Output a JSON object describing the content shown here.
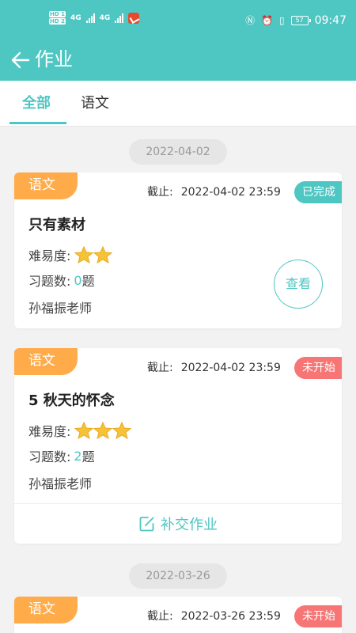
{
  "status_bar": {
    "network_hd1": "HD 1",
    "network_hd2": "HD 2",
    "net_label": "4G",
    "battery": "57",
    "time": "09:47"
  },
  "header": {
    "title": "作业",
    "back_icon": "arrow-left-icon"
  },
  "tabs": [
    {
      "label": "全部",
      "active": true
    },
    {
      "label": "语文",
      "active": false
    }
  ],
  "labels": {
    "deadline": "截止:",
    "difficulty": "难易度:",
    "question_count": "习题数:",
    "question_unit": "题",
    "view_button": "查看",
    "resubmit_button": "补交作业"
  },
  "groups": [
    {
      "date": "2022-04-02",
      "cards": [
        {
          "subject": "语文",
          "deadline": "2022-04-02 23:59",
          "status": "已完成",
          "status_color": "#4ec6c2",
          "title": "只有素材",
          "difficulty_stars": 2,
          "question_count": "0",
          "teacher": "孙福振老师",
          "action": "view"
        },
        {
          "subject": "语文",
          "deadline": "2022-04-02 23:59",
          "status": "未开始",
          "status_color": "#f77575",
          "title": "5 秋天的怀念",
          "difficulty_stars": 3,
          "question_count": "2",
          "teacher": "孙福振老师",
          "action": "resubmit"
        }
      ]
    },
    {
      "date": "2022-03-26",
      "cards": [
        {
          "subject": "语文",
          "deadline": "2022-03-26 23:59",
          "status": "未开始",
          "status_color": "#f77575"
        }
      ]
    }
  ],
  "colors": {
    "accent": "#4ec6c2",
    "subject_tag": "#ffab4a",
    "star": "#f6c238"
  }
}
